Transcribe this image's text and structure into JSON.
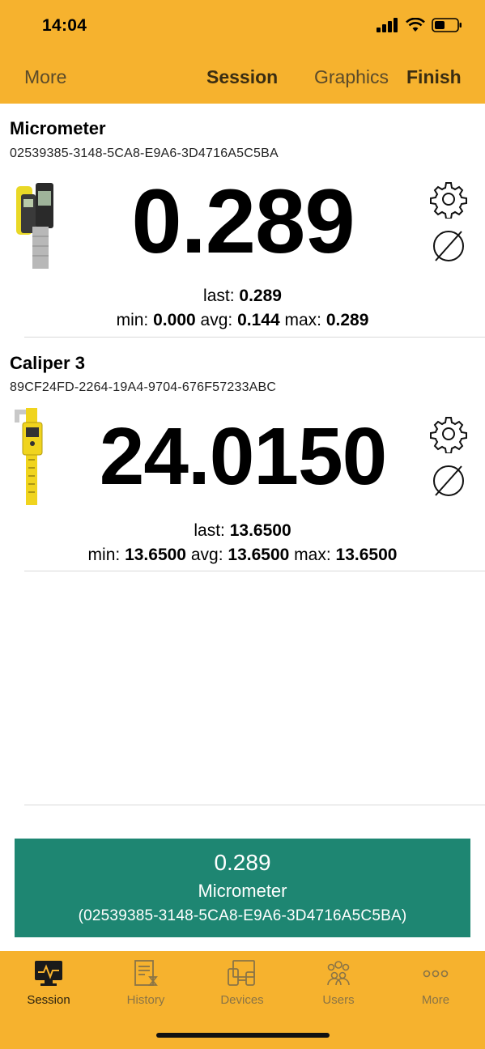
{
  "status_bar": {
    "time": "14:04"
  },
  "nav": {
    "more": "More",
    "session": "Session",
    "graphics": "Graphics",
    "finish": "Finish"
  },
  "devices": [
    {
      "name": "Micrometer",
      "id": "02539385-3148-5CA8-E9A6-3D4716A5C5BA",
      "value": "0.289",
      "last_label": "last:",
      "last": "0.289",
      "min_label": "min:",
      "min": "0.000",
      "avg_label": "avg:",
      "avg": "0.144",
      "max_label": "max:",
      "max": "0.289",
      "image": "micrometer-image"
    },
    {
      "name": "Caliper 3",
      "id": "89CF24FD-2264-19A4-9704-676F57233ABC",
      "value": "24.0150",
      "last_label": "last:",
      "last": "13.6500",
      "min_label": "min:",
      "min": "13.6500",
      "avg_label": "avg:",
      "avg": "13.6500",
      "max_label": "max:",
      "max": "13.6500",
      "image": "caliper-image"
    }
  ],
  "summary": {
    "value": "0.289",
    "name": "Micrometer",
    "id": "(02539385-3148-5CA8-E9A6-3D4716A5C5BA)"
  },
  "tabs": [
    {
      "label": "Session",
      "icon": "monitor-icon",
      "active": true
    },
    {
      "label": "History",
      "icon": "history-icon",
      "active": false
    },
    {
      "label": "Devices",
      "icon": "devices-icon",
      "active": false
    },
    {
      "label": "Users",
      "icon": "users-icon",
      "active": false
    },
    {
      "label": "More",
      "icon": "more-icon",
      "active": false
    }
  ],
  "colors": {
    "header": "#F6B22E",
    "summary": "#1E8672",
    "tabbar": "#F6B22E"
  }
}
